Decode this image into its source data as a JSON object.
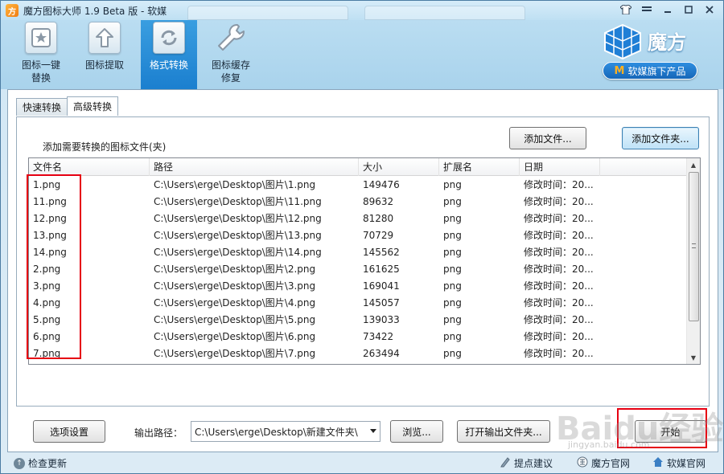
{
  "window": {
    "title": "魔方图标大师 1.9 Beta 版 - 软媒",
    "controls": [
      "shirt-icon",
      "menu-icon",
      "minimize-icon",
      "maximize-icon",
      "close-icon"
    ]
  },
  "toolbar": {
    "items": [
      {
        "label": "图标一键\n替换",
        "icon": "star-icon",
        "active": false
      },
      {
        "label": "图标提取",
        "icon": "arrow-up-icon",
        "active": false
      },
      {
        "label": "格式转换",
        "icon": "refresh-icon",
        "active": true
      },
      {
        "label": "图标缓存\n修复",
        "icon": "wrench-icon",
        "active": false
      }
    ],
    "brand_name": "魔方",
    "brand_badge": "软媒旗下产品",
    "brand_badge_mark": "M"
  },
  "tabs": [
    {
      "label": "快速转换",
      "active": false
    },
    {
      "label": "高级转换",
      "active": true
    }
  ],
  "advanced": {
    "hint": "添加需要转换的图标文件(夹)",
    "add_file_label": "添加文件...",
    "add_folder_label": "添加文件夹..."
  },
  "table": {
    "columns": [
      "文件名",
      "路径",
      "大小",
      "扩展名",
      "日期",
      ""
    ],
    "rows": [
      {
        "name": "1.png",
        "path": "C:\\Users\\erge\\Desktop\\图片\\1.png",
        "size": "149476",
        "ext": "png",
        "date": "修改时间：20..."
      },
      {
        "name": "11.png",
        "path": "C:\\Users\\erge\\Desktop\\图片\\11.png",
        "size": "89632",
        "ext": "png",
        "date": "修改时间：20..."
      },
      {
        "name": "12.png",
        "path": "C:\\Users\\erge\\Desktop\\图片\\12.png",
        "size": "81280",
        "ext": "png",
        "date": "修改时间：20..."
      },
      {
        "name": "13.png",
        "path": "C:\\Users\\erge\\Desktop\\图片\\13.png",
        "size": "70729",
        "ext": "png",
        "date": "修改时间：20..."
      },
      {
        "name": "14.png",
        "path": "C:\\Users\\erge\\Desktop\\图片\\14.png",
        "size": "145562",
        "ext": "png",
        "date": "修改时间：20..."
      },
      {
        "name": "2.png",
        "path": "C:\\Users\\erge\\Desktop\\图片\\2.png",
        "size": "161625",
        "ext": "png",
        "date": "修改时间：20..."
      },
      {
        "name": "3.png",
        "path": "C:\\Users\\erge\\Desktop\\图片\\3.png",
        "size": "169041",
        "ext": "png",
        "date": "修改时间：20..."
      },
      {
        "name": "4.png",
        "path": "C:\\Users\\erge\\Desktop\\图片\\4.png",
        "size": "145057",
        "ext": "png",
        "date": "修改时间：20..."
      },
      {
        "name": "5.png",
        "path": "C:\\Users\\erge\\Desktop\\图片\\5.png",
        "size": "139033",
        "ext": "png",
        "date": "修改时间：20..."
      },
      {
        "name": "6.png",
        "path": "C:\\Users\\erge\\Desktop\\图片\\6.png",
        "size": "73422",
        "ext": "png",
        "date": "修改时间：20..."
      },
      {
        "name": "7.png",
        "path": "C:\\Users\\erge\\Desktop\\图片\\7.png",
        "size": "263494",
        "ext": "png",
        "date": "修改时间：20..."
      }
    ]
  },
  "bottom": {
    "options_label": "选项设置",
    "output_label": "输出路径：",
    "output_path": "C:\\Users\\erge\\Desktop\\新建文件夹\\",
    "browse_label": "浏览...",
    "open_output_label": "打开输出文件夹...",
    "start_label": "开始"
  },
  "status": {
    "check_update": "检查更新",
    "suggest": "提点建议",
    "mofang_site": "魔方官网",
    "ruanmei_site": "软媒官网"
  },
  "watermark": {
    "main": "Baidu经验",
    "sub": "jingyan.baidu.com"
  },
  "colors": {
    "active_tab": "#1b7fcf",
    "highlight": "#e60012",
    "brand_blue": "#1566b8"
  }
}
